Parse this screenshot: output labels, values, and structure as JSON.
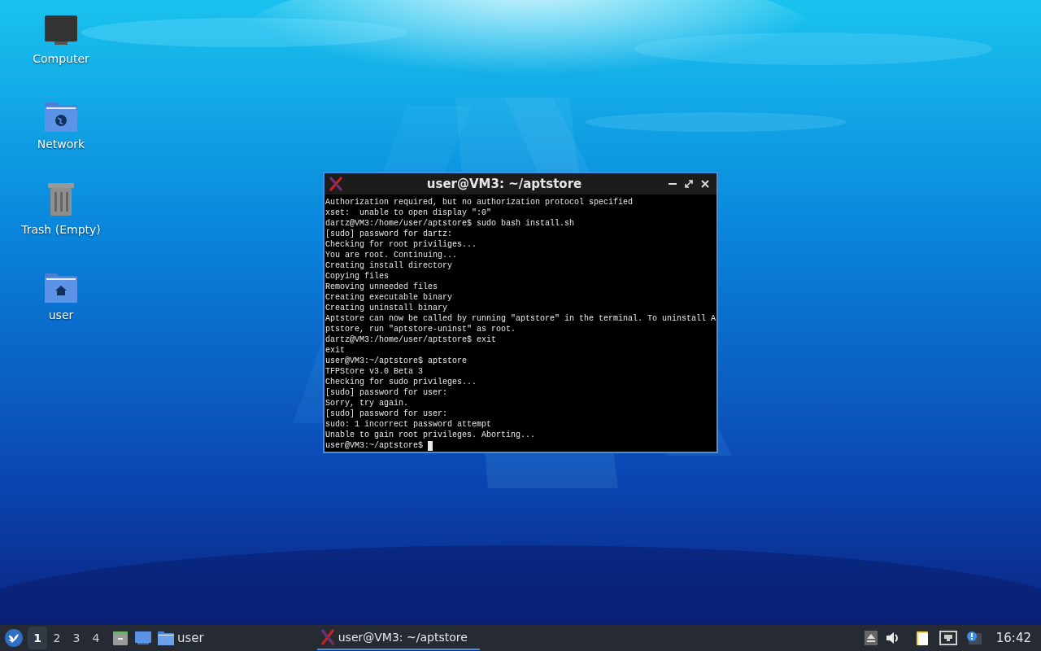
{
  "desktop_icons": [
    {
      "label": "Computer",
      "kind": "computer"
    },
    {
      "label": "Network",
      "kind": "network"
    },
    {
      "label": "Trash (Empty)",
      "kind": "trash"
    },
    {
      "label": "user",
      "kind": "home"
    }
  ],
  "terminal": {
    "title": "user@VM3: ~/aptstore",
    "cursor": true,
    "lines": [
      "Authorization required, but no authorization protocol specified",
      "xset:  unable to open display \":0\"",
      "dartz@VM3:/home/user/aptstore$ sudo bash install.sh",
      "[sudo] password for dartz:",
      "Checking for root priviliges...",
      "You are root. Continuing...",
      "Creating install directory",
      "Copying files",
      "Removing unneeded files",
      "Creating executable binary",
      "Creating uninstall binary",
      "Aptstore can now be called by running \"aptstore\" in the terminal. To uninstall A",
      "ptstore, run \"aptstore-uninst\" as root.",
      "dartz@VM3:/home/user/aptstore$ exit",
      "exit",
      "user@VM3:~/aptstore$ aptstore",
      "TFPStore v3.0 Beta 3",
      "Checking for sudo privileges...",
      "[sudo] password for user:",
      "Sorry, try again.",
      "[sudo] password for user:",
      "sudo: 1 incorrect password attempt",
      "Unable to gain root privileges. Aborting...",
      "user@VM3:~/aptstore$ "
    ]
  },
  "taskbar": {
    "workspaces": [
      {
        "label": "1",
        "selected": true
      },
      {
        "label": "2",
        "selected": false
      },
      {
        "label": "3",
        "selected": false
      },
      {
        "label": "4",
        "selected": false
      }
    ],
    "launchers": [
      {
        "kind": "files"
      },
      {
        "kind": "desktop"
      },
      {
        "kind": "folder",
        "label": "user"
      }
    ],
    "windows": [
      {
        "title": "user@VM3: ~/aptstore",
        "selected": true
      }
    ],
    "clock": "16:42"
  }
}
